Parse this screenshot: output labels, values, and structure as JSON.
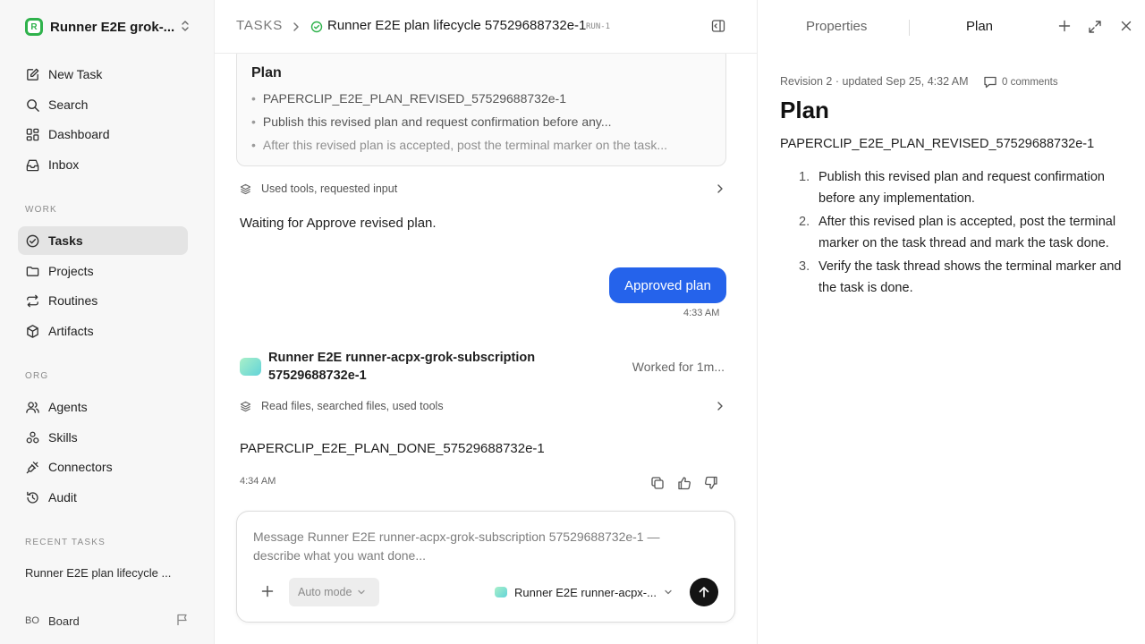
{
  "workspace": {
    "name": "Runner E2E grok-...",
    "logo_letter": "R"
  },
  "nav": {
    "primary": [
      {
        "label": "New Task",
        "icon": "edit-icon"
      },
      {
        "label": "Search",
        "icon": "search-icon"
      },
      {
        "label": "Dashboard",
        "icon": "dashboard-icon"
      },
      {
        "label": "Inbox",
        "icon": "inbox-icon"
      }
    ],
    "work_section": "WORK",
    "work": [
      {
        "label": "Tasks",
        "icon": "check-circle-icon",
        "active": true
      },
      {
        "label": "Projects",
        "icon": "folder-icon"
      },
      {
        "label": "Routines",
        "icon": "repeat-icon"
      },
      {
        "label": "Artifacts",
        "icon": "box-icon"
      }
    ],
    "org_section": "ORG",
    "org": [
      {
        "label": "Agents",
        "icon": "users-icon"
      },
      {
        "label": "Skills",
        "icon": "skills-icon"
      },
      {
        "label": "Connectors",
        "icon": "plug-icon"
      },
      {
        "label": "Audit",
        "icon": "history-icon"
      }
    ],
    "recent_section": "RECENT TASKS",
    "recent_task": "Runner E2E plan lifecycle ...",
    "board": {
      "initials": "BO",
      "label": "Board"
    }
  },
  "header": {
    "root": "TASKS",
    "title": "Runner E2E plan lifecycle 57529688732e-1",
    "run_id": "RUN-1"
  },
  "thread": {
    "plan_card": {
      "title": "Plan",
      "items": [
        "PAPERCLIP_E2E_PLAN_REVISED_57529688732e-1",
        "Publish this revised plan and request confirmation before any...",
        "After this revised plan is accepted, post the terminal marker on the task..."
      ]
    },
    "tools_summary_1": "Used tools, requested input",
    "waiting_text": "Waiting for Approve revised plan.",
    "user_bubble": "Approved plan",
    "user_time": "4:33 AM",
    "agent_name": "Runner E2E runner-acpx-grok-subscription 57529688732e-1",
    "worked_for": "Worked for 1m...",
    "tools_summary_2": "Read files, searched files, used tools",
    "done_marker": "PAPERCLIP_E2E_PLAN_DONE_57529688732e-1",
    "done_time": "4:34 AM"
  },
  "composer": {
    "placeholder": "Message Runner E2E runner-acpx-grok-subscription 57529688732e-1 — describe what you want done...",
    "mode": "Auto mode",
    "agent": "Runner E2E runner-acpx-..."
  },
  "right_panel": {
    "tabs": [
      "Properties",
      "Plan"
    ],
    "active_tab": "Plan",
    "revision": "Revision 2 · updated Sep 25, 4:32 AM",
    "comments": "0 comments",
    "title": "Plan",
    "summary": "PAPERCLIP_E2E_PLAN_REVISED_57529688732e-1",
    "steps": [
      {
        "num": "1.",
        "text": "Publish this revised plan and request confirmation before any implementation."
      },
      {
        "num": "2.",
        "text": "After this revised plan is accepted, post the terminal marker on the task thread and mark the task done."
      },
      {
        "num": "3.",
        "text": "Verify the task thread shows the terminal marker and the task is done."
      }
    ]
  },
  "colors": {
    "accent_blue": "#2563eb",
    "brand_green": "#2fb24c",
    "active_nav": "#e4e4e4"
  }
}
